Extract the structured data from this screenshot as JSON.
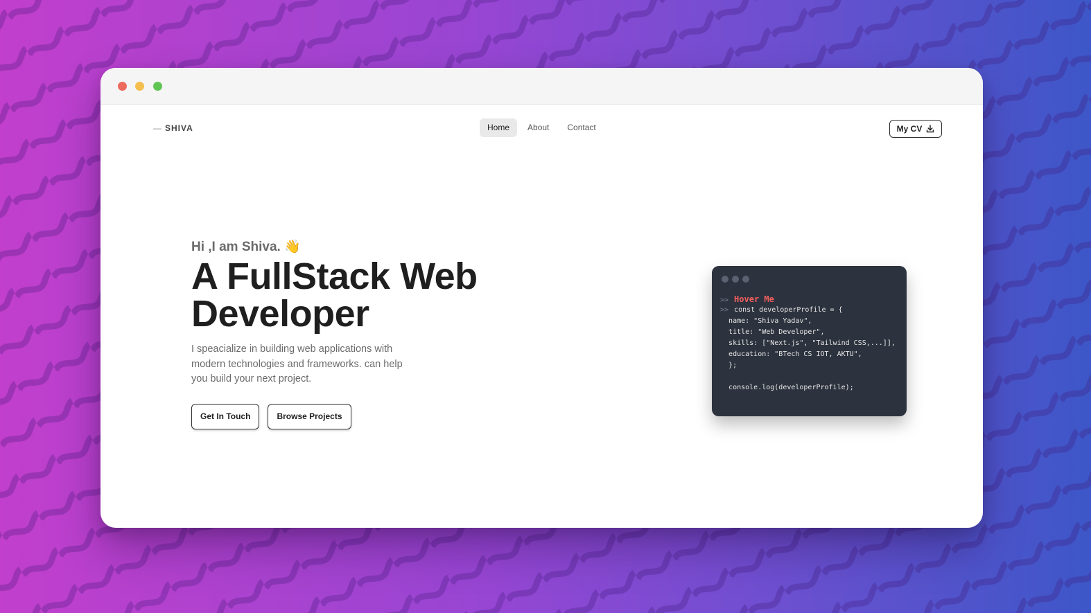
{
  "window": {
    "controls": [
      "close",
      "minimize",
      "maximize"
    ]
  },
  "nav": {
    "logo": "SHIVA",
    "logo_prefix": "—",
    "items": [
      {
        "label": "Home",
        "active": true
      },
      {
        "label": "About",
        "active": false
      },
      {
        "label": "Contact",
        "active": false
      }
    ],
    "cv_button": "My CV",
    "cv_icon": "download-icon"
  },
  "hero": {
    "greeting": "Hi ,I am Shiva. 👋",
    "headline_line1": "A FullStack Web",
    "headline_line2": "Developer",
    "description": "I speacialize in building web applications with modern technologies and frameworks. can help you build your next project.",
    "buttons": {
      "contact": "Get In Touch",
      "projects": "Browse Projects"
    }
  },
  "code_card": {
    "prompt": ">>",
    "hover_label": "Hover Me",
    "lines": [
      "const developerProfile = {",
      "name: \"Shiva Yadav\",",
      "title: \"Web Developer\",",
      "skills: [\"Next.js\", \"Tailwind CSS,...]],",
      "education: \"BTech CS IOT, AKTU\",",
      "};",
      "",
      "console.log(developerProfile);"
    ]
  },
  "colors": {
    "accent_hover": "#f35f5f",
    "code_bg": "#2d333e",
    "background_from": "#c13fcc",
    "background_to": "#3d57c8"
  }
}
